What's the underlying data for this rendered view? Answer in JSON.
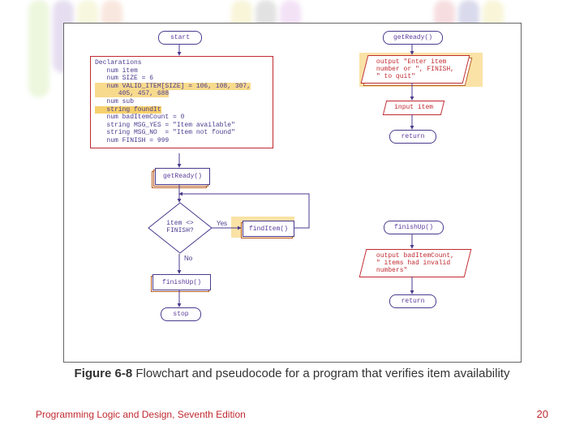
{
  "figure": {
    "label_prefix": "Figure 6-8",
    "caption_rest": " Flowchart and pseudocode for a program that verifies item availability"
  },
  "footer": {
    "left": "Programming Logic and Design, Seventh Edition",
    "page": "20"
  },
  "flow": {
    "left_col": {
      "start": "start",
      "decl_heading": "Declarations",
      "decl_body_lines": [
        "   num item",
        "   num SIZE = 6",
        "   num VALID_ITEM[SIZE] = 106, 108, 307,",
        "      405, 457, 688",
        "   num sub",
        "   string foundIt",
        "   num badItemCount = 0",
        "   string MSG_YES = \"Item available\"",
        "   string MSG_NO  = \"Item not found\"",
        "   num FINISH = 999"
      ],
      "getReady": "getReady()",
      "decision": "item <>\nFINISH?",
      "decision_yes": "Yes",
      "decision_no": "No",
      "findItem": "findItem()",
      "finishUp": "finishUp()",
      "stop": "stop"
    },
    "getReady_sub": {
      "head": "getReady()",
      "output": "output \"Enter item\n  number or \", FINISH,\n  \" to quit\"",
      "input": "input item",
      "return": "return"
    },
    "finishUp_sub": {
      "head": "finishUp()",
      "output": "output badItemCount,\n  \" items had invalid\n  numbers\"",
      "return": "return"
    }
  },
  "chart_data": {
    "type": "flowchart",
    "title": "Figure 6-8 Flowchart and pseudocode for a program that verifies item availability",
    "main_routine": {
      "nodes": [
        {
          "id": "start",
          "kind": "terminal",
          "label": "start"
        },
        {
          "id": "declarations",
          "kind": "process",
          "label": "Declarations\n  num item\n  num SIZE = 6\n  num VALID_ITEM[SIZE] = 106, 108, 307, 405, 457, 688\n  num sub\n  string foundIt\n  num badItemCount = 0\n  string MSG_YES = \"Item available\"\n  string MSG_NO  = \"Item not found\"\n  num FINISH = 999"
        },
        {
          "id": "call_getReady",
          "kind": "process",
          "label": "getReady()"
        },
        {
          "id": "decide_loop",
          "kind": "decision",
          "label": "item <> FINISH?"
        },
        {
          "id": "call_findItem",
          "kind": "process",
          "label": "findItem()"
        },
        {
          "id": "call_finishUp",
          "kind": "process",
          "label": "finishUp()"
        },
        {
          "id": "stop",
          "kind": "terminal",
          "label": "stop"
        }
      ],
      "edges": [
        {
          "from": "start",
          "to": "declarations"
        },
        {
          "from": "declarations",
          "to": "call_getReady"
        },
        {
          "from": "call_getReady",
          "to": "decide_loop"
        },
        {
          "from": "decide_loop",
          "to": "call_findItem",
          "label": "Yes"
        },
        {
          "from": "call_findItem",
          "to": "decide_loop",
          "note": "loop back"
        },
        {
          "from": "decide_loop",
          "to": "call_finishUp",
          "label": "No"
        },
        {
          "from": "call_finishUp",
          "to": "stop"
        }
      ]
    },
    "sub_getReady": {
      "nodes": [
        {
          "id": "gr_head",
          "kind": "terminal",
          "label": "getReady()"
        },
        {
          "id": "gr_out",
          "kind": "io",
          "label": "output \"Enter item number or \", FINISH, \" to quit\""
        },
        {
          "id": "gr_in",
          "kind": "io",
          "label": "input item"
        },
        {
          "id": "gr_return",
          "kind": "terminal",
          "label": "return"
        }
      ],
      "edges": [
        {
          "from": "gr_head",
          "to": "gr_out"
        },
        {
          "from": "gr_out",
          "to": "gr_in"
        },
        {
          "from": "gr_in",
          "to": "gr_return"
        }
      ]
    },
    "sub_finishUp": {
      "nodes": [
        {
          "id": "fu_head",
          "kind": "terminal",
          "label": "finishUp()"
        },
        {
          "id": "fu_out",
          "kind": "io",
          "label": "output badItemCount, \" items had invalid numbers\""
        },
        {
          "id": "fu_return",
          "kind": "terminal",
          "label": "return"
        }
      ],
      "edges": [
        {
          "from": "fu_head",
          "to": "fu_out"
        },
        {
          "from": "fu_out",
          "to": "fu_return"
        }
      ]
    },
    "declared_data": {
      "SIZE": 6,
      "VALID_ITEM": [
        106,
        108,
        307,
        405,
        457,
        688
      ],
      "badItemCount": 0,
      "MSG_YES": "Item available",
      "MSG_NO": "Item not found",
      "FINISH": 999
    }
  }
}
